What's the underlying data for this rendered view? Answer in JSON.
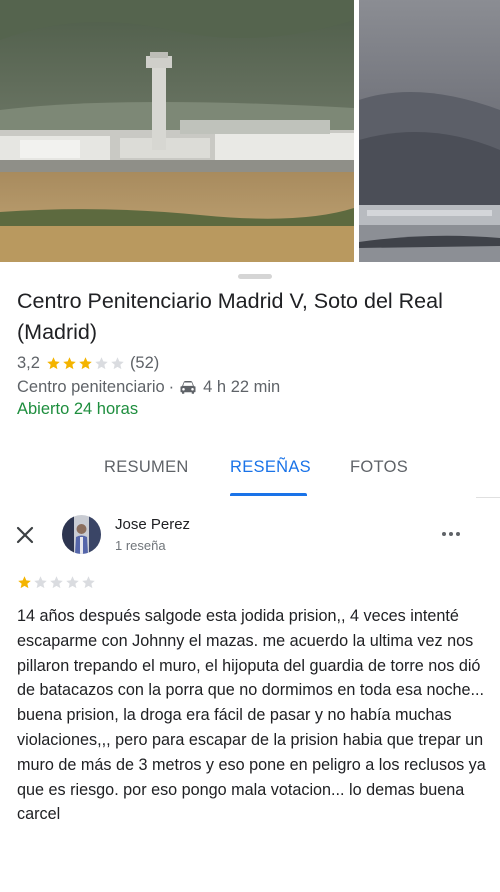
{
  "place": {
    "title": "Centro Penitenciario Madrid V, Soto del Real (Madrid)",
    "rating": "3,2",
    "stars_filled": 3,
    "review_count": "(52)",
    "category": "Centro penitenciario",
    "separator": "·",
    "travel_time": "4 h 22 min",
    "hours_status": "Abierto 24 horas"
  },
  "tabs": [
    {
      "label": "RESUMEN",
      "active": false
    },
    {
      "label": "RESEÑAS",
      "active": true
    },
    {
      "label": "FOTOS",
      "active": false
    }
  ],
  "review": {
    "author": "Jose Perez",
    "author_reviews": "1 reseña",
    "stars_filled": 1,
    "text": "14 años después salgode esta jodida prision,, 4 veces intenté escaparme con Johnny el mazas. me acuerdo la ultima vez nos pillaron trepando el muro, el hijoputa del guardia de torre nos dió de batacazos con la porra que no dormimos en toda esa noche... buena prision, la droga era fácil de pasar y no había muchas violaciones,,, pero para escapar de la prision habia que trepar un muro de más de 3 metros y eso pone en peligro a los reclusos ya que es riesgo.  por eso pongo mala votacion... lo demas buena carcel"
  },
  "colors": {
    "star_filled": "#f4b400",
    "star_empty": "#dadce0",
    "accent": "#1a73e8",
    "open_green": "#1e8e3e"
  },
  "icons": [
    "close-icon",
    "car-icon",
    "more-options-icon",
    "star-icon"
  ]
}
